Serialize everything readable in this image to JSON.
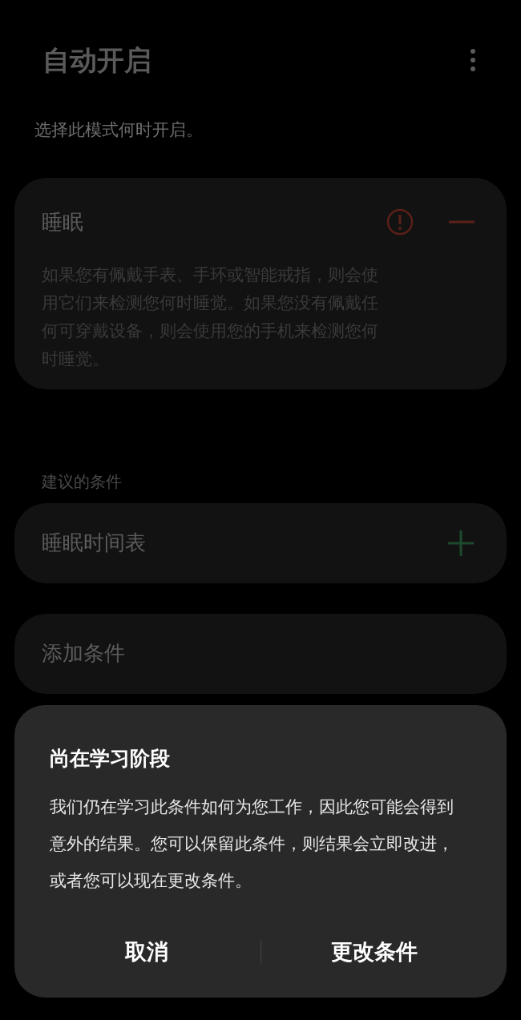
{
  "header": {
    "title": "自动开启"
  },
  "subtitle": "选择此模式何时开启。",
  "condition": {
    "title": "睡眠",
    "description": "如果您有佩戴手表、手环或智能戒指，则会使用它们来检测您何时睡觉。如果您没有佩戴任何可穿戴设备，则会使用您的手机来检测您何时睡觉。"
  },
  "suggested": {
    "heading": "建议的条件",
    "items": [
      {
        "label": "睡眠时间表"
      }
    ]
  },
  "add_condition": "添加条件",
  "dialog": {
    "title": "尚在学习阶段",
    "message": "我们仍在学习此条件如何为您工作，因此您可能会得到意外的结果。您可以保留此条件，则结果会立即改进，或者您可以现在更改条件。",
    "buttons": [
      "取消",
      "更改条件"
    ]
  }
}
